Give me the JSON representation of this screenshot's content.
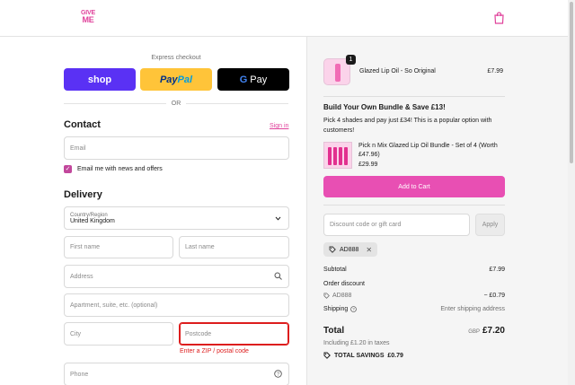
{
  "header": {
    "logo_line1": "GIVE",
    "logo_line2": "ME",
    "brand_color": "#e0429b"
  },
  "express": {
    "title": "Express checkout",
    "shop_label": "shop",
    "paypal_part1": "Pay",
    "paypal_part2": "Pal",
    "gpay_g": "G",
    "gpay_label": "Pay",
    "or_label": "OR"
  },
  "contact": {
    "title": "Contact",
    "sign_in": "Sign in",
    "email_placeholder": "Email",
    "newsletter_label": "Email me with news and offers",
    "newsletter_checked": true
  },
  "delivery": {
    "title": "Delivery",
    "country_label": "Country/Region",
    "country_value": "United Kingdom",
    "first_name_placeholder": "First name",
    "last_name_placeholder": "Last name",
    "address_placeholder": "Address",
    "apartment_placeholder": "Apartment, suite, etc. (optional)",
    "city_placeholder": "City",
    "postcode_placeholder": "Postcode",
    "postcode_error": "Enter a ZIP / postal code",
    "phone_placeholder": "Phone"
  },
  "summary": {
    "product": {
      "name": "Glazed Lip Oil - So Original",
      "price": "£7.99",
      "quantity": "1"
    },
    "bundle": {
      "title": "Build Your Own Bundle & Save £13!",
      "description": "Pick 4 shades and pay just £34! This is a popular option with customers!",
      "name": "Pick n Mix Glazed Lip Oil Bundle - Set of 4 (Worth £47.96)",
      "price": "£29.99",
      "add_to_cart": "Add to Cart"
    },
    "discount_placeholder": "Discount code or gift card",
    "apply_label": "Apply",
    "applied_code": "AD888",
    "subtotal_label": "Subtotal",
    "subtotal_value": "£7.99",
    "order_discount_label": "Order discount",
    "discount_code": "AD888",
    "discount_value": "− £0.79",
    "shipping_label": "Shipping",
    "shipping_value": "Enter shipping address",
    "total_label": "Total",
    "currency": "GBP",
    "total_value": "£7.20",
    "taxes": "Including £1.20 in taxes",
    "total_savings": "TOTAL SAVINGS  £0.79"
  }
}
